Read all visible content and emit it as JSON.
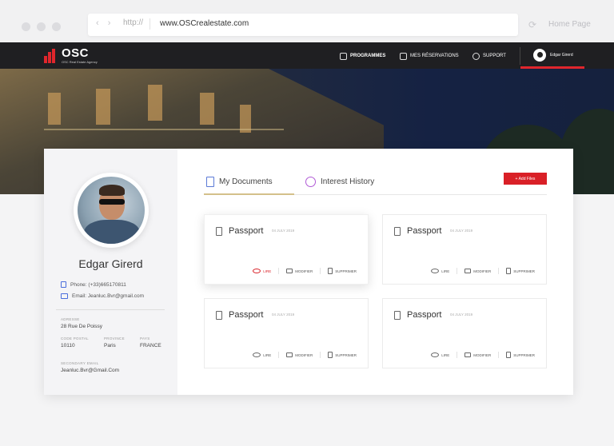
{
  "browser": {
    "protocol": "http://",
    "url": "www.OSCrealestate.com",
    "home_label": "Home Page"
  },
  "nav": {
    "brand": "OSC",
    "brand_sub": "OSC Real Estate Agency",
    "items": [
      {
        "label": "PROGRAMMES",
        "icon": "building-icon"
      },
      {
        "label": "MES RÉSERVATIONS",
        "icon": "clipboard-icon"
      },
      {
        "label": "SUPPORT",
        "icon": "gears-icon"
      }
    ],
    "user_name": "Edgar Girerd",
    "accent": "#e0262c"
  },
  "profile": {
    "name": "Edgar Girerd",
    "phone": "Phone: (+33)665170811",
    "email": "Email: Jeanluc.Bvr@gmail.com",
    "address_label": "ADRESSE",
    "address": "28 Rue De Poissy",
    "postal_label": "CODE POSTAL",
    "postal": "10110",
    "province_label": "PROVINCE",
    "province": "Paris",
    "country_label": "PAYS",
    "country": "FRANCE",
    "secondary_email_label": "SECONDARY EMAIL",
    "secondary_email": "Jeanluc.Bvr@Gmail.Com"
  },
  "tabs": [
    {
      "label": "My Documents",
      "active": true
    },
    {
      "label": "Interest History",
      "active": false
    }
  ],
  "add_files": "+ Add Files",
  "actions": {
    "read": "LIRE",
    "edit": "MODIFIER",
    "delete": "SUPPRIMER"
  },
  "documents": [
    {
      "title": "Passport",
      "date": "04 JULY 2019"
    },
    {
      "title": "Passport",
      "date": "04 JULY 2019"
    },
    {
      "title": "Passport",
      "date": "04 JULY 2019"
    },
    {
      "title": "Passport",
      "date": "04 JULY 2019"
    }
  ]
}
